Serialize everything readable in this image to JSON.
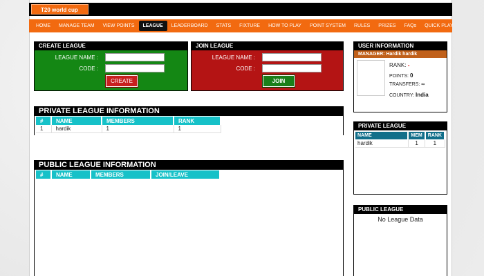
{
  "brand": "T20 world cup",
  "nav": [
    "HOME",
    "MANAGE TEAM",
    "VIEW POINTS",
    "LEAGUE",
    "LEADERBOARD",
    "STATS",
    "FIXTURE",
    "HOW TO PLAY",
    "POINT SYSTEM",
    "RULES",
    "PRIZES",
    "FAQs",
    "QUICK PLAY"
  ],
  "nav_active": "LEAGUE",
  "create": {
    "title": "CREATE LEAGUE",
    "league_name_label": "LEAGUE NAME :",
    "code_label": "CODE :",
    "league_name_value": "",
    "code_value": "",
    "button": "CREATE"
  },
  "join": {
    "title": "JOIN LEAGUE",
    "league_name_label": "LEAGUE NAME :",
    "code_label": "CODE :",
    "league_name_value": "",
    "code_value": "",
    "button": "JOIN"
  },
  "private_info": {
    "title": "PRIVATE LEAGUE INFORMATION",
    "headers": [
      "#",
      "NAME",
      "MEMBERS",
      "RANK"
    ],
    "rows": [
      [
        "1",
        "hardik",
        "1",
        "1"
      ]
    ]
  },
  "public_info": {
    "title": "PUBLIC LEAGUE INFORMATION",
    "headers": [
      "#",
      "NAME",
      "MEMBERS",
      "JOIN/LEAVE"
    ]
  },
  "user": {
    "title": "USER INFORMATION",
    "manager": "MANAGER: Hardik hardik",
    "rank_label": "RANK:",
    "rank_value": "-",
    "points_label": "POINTS:",
    "points_value": "0",
    "transfers_label": "TRANSFERS:",
    "transfers_value": "∞",
    "country_label": "COUNTRY:",
    "country_value": "India"
  },
  "side_private": {
    "title": "PRIVATE LEAGUE",
    "headers": [
      "NAME",
      "MEM",
      "RANK"
    ],
    "rows": [
      [
        "hardik",
        "1",
        "1"
      ]
    ]
  },
  "side_public": {
    "title": "PUBLIC LEAGUE",
    "empty": "No League Data"
  },
  "colors": {
    "orange": "#f26a10",
    "create_green": "#148714",
    "join_red": "#b41414",
    "teal_header": "#16c1c8",
    "dark_teal_header": "#126f8a"
  }
}
